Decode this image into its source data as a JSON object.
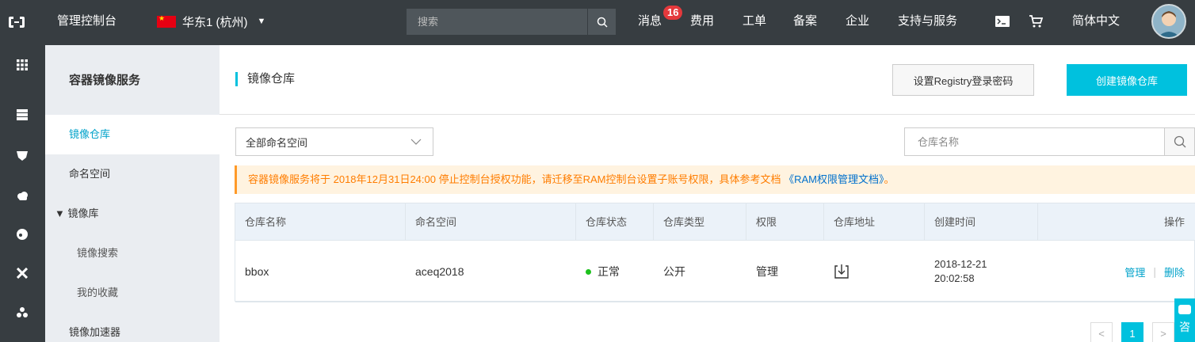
{
  "topbar": {
    "console_title": "管理控制台",
    "region": "华东1 (杭州)",
    "search_placeholder": "搜索",
    "messages_label": "消息",
    "messages_count": "16",
    "nav": [
      "费用",
      "工单",
      "备案",
      "企业",
      "支持与服务"
    ],
    "language": "简体中文"
  },
  "sidenav": {
    "title": "容器镜像服务",
    "items": [
      {
        "label": "镜像仓库"
      },
      {
        "label": "命名空间"
      },
      {
        "label": "▼ 镜像库"
      },
      {
        "label": "镜像搜索"
      },
      {
        "label": "我的收藏"
      },
      {
        "label": "镜像加速器"
      }
    ]
  },
  "main": {
    "title": "镜像仓库",
    "set_password_button": "设置Registry登录密码",
    "create_button": "创建镜像仓库",
    "namespace_select": "全部命名空间",
    "repo_search_placeholder": "仓库名称",
    "notice_text": "容器镜像服务将于 2018年12月31日24:00 停止控制台授权功能，请迁移至RAM控制台设置子账号权限，具体参考文档 ",
    "notice_link": "《RAM权限管理文档》",
    "notice_end": "。",
    "table": {
      "headers": [
        "仓库名称",
        "命名空间",
        "仓库状态",
        "仓库类型",
        "权限",
        "仓库地址",
        "创建时间",
        "操作"
      ],
      "rows": [
        {
          "name": "bbox",
          "namespace": "aceq2018",
          "status": "正常",
          "type": "公开",
          "permission": "管理",
          "created_date": "2018-12-21",
          "created_time": "20:02:58",
          "action_manage": "管理",
          "action_delete": "删除"
        }
      ]
    },
    "pagination": {
      "prev": "<",
      "current": "1",
      "next": ">"
    }
  },
  "consult": "咨",
  "colors": {
    "topbar": "#373d41",
    "accent": "#00c1de",
    "link": "#00a2ca",
    "notice": "#ff7d00"
  }
}
